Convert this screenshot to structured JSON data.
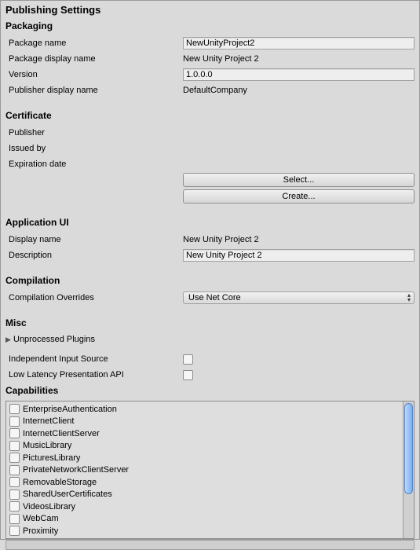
{
  "title": "Publishing Settings",
  "sections": {
    "packaging": {
      "title": "Packaging",
      "package_name_label": "Package name",
      "package_name_value": "NewUnityProject2",
      "package_display_name_label": "Package display name",
      "package_display_name_value": "New Unity Project 2",
      "version_label": "Version",
      "version_value": "1.0.0.0",
      "publisher_display_name_label": "Publisher display name",
      "publisher_display_name_value": "DefaultCompany"
    },
    "certificate": {
      "title": "Certificate",
      "publisher_label": "Publisher",
      "issued_by_label": "Issued by",
      "expiration_label": "Expiration date",
      "select_button": "Select...",
      "create_button": "Create..."
    },
    "app_ui": {
      "title": "Application UI",
      "display_name_label": "Display name",
      "display_name_value": "New Unity Project 2",
      "description_label": "Description",
      "description_value": "New Unity Project 2"
    },
    "compilation": {
      "title": "Compilation",
      "overrides_label": "Compilation Overrides",
      "overrides_value": "Use Net Core"
    },
    "misc": {
      "title": "Misc",
      "unprocessed_plugins_label": "Unprocessed Plugins",
      "independent_input_label": "Independent Input Source",
      "independent_input_checked": false,
      "low_latency_label": "Low Latency Presentation API",
      "low_latency_checked": false
    },
    "capabilities": {
      "title": "Capabilities",
      "items": [
        {
          "label": "EnterpriseAuthentication",
          "checked": false
        },
        {
          "label": "InternetClient",
          "checked": false
        },
        {
          "label": "InternetClientServer",
          "checked": false
        },
        {
          "label": "MusicLibrary",
          "checked": false
        },
        {
          "label": "PicturesLibrary",
          "checked": false
        },
        {
          "label": "PrivateNetworkClientServer",
          "checked": false
        },
        {
          "label": "RemovableStorage",
          "checked": false
        },
        {
          "label": "SharedUserCertificates",
          "checked": false
        },
        {
          "label": "VideosLibrary",
          "checked": false
        },
        {
          "label": "WebCam",
          "checked": false
        },
        {
          "label": "Proximity",
          "checked": false
        }
      ]
    }
  }
}
